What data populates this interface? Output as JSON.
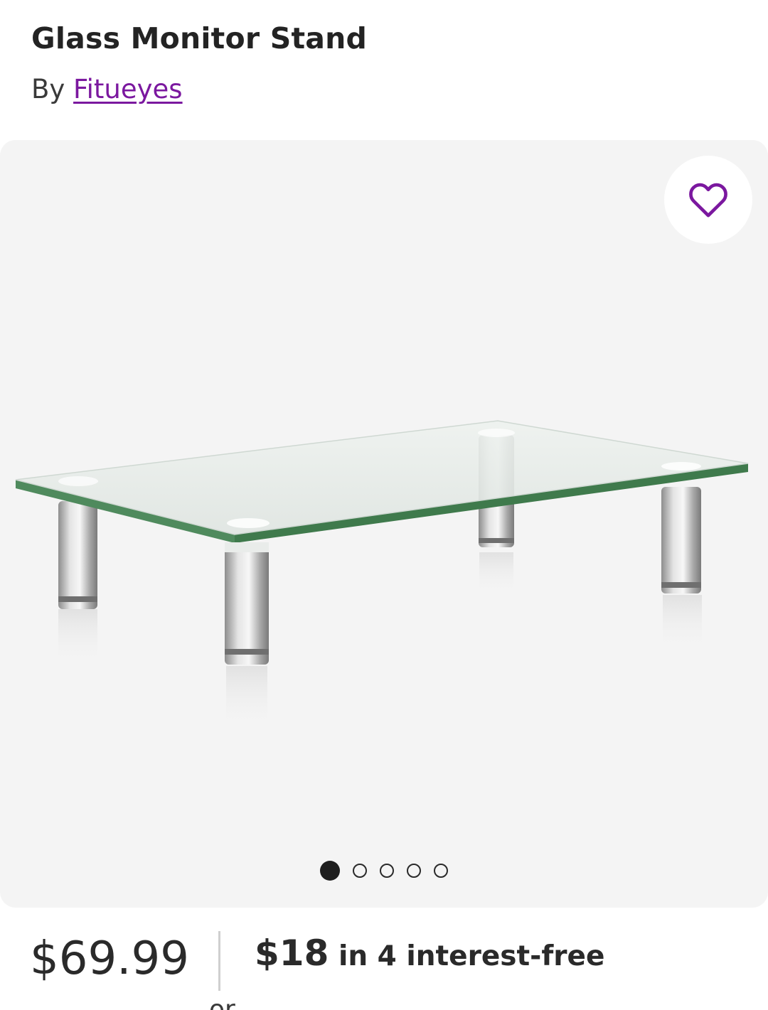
{
  "product": {
    "title": "Glass Monitor Stand",
    "by_prefix": "By",
    "brand": "Fitueyes"
  },
  "gallery": {
    "image_alt": "Glass Monitor Stand",
    "favorite_icon": "heart-outline-icon",
    "slide_count": 5,
    "active_slide": 0
  },
  "pricing": {
    "price": "$69.99",
    "installment_amount": "$18",
    "installment_text": "in 4 interest-free",
    "installment_line2_start": "or",
    "affirm_icon": "affirm-logo",
    "info_icon": "info-icon"
  },
  "colors": {
    "brand_purple": "#7b189f",
    "gallery_bg": "#f4f4f4",
    "text": "#2a2a2a"
  }
}
